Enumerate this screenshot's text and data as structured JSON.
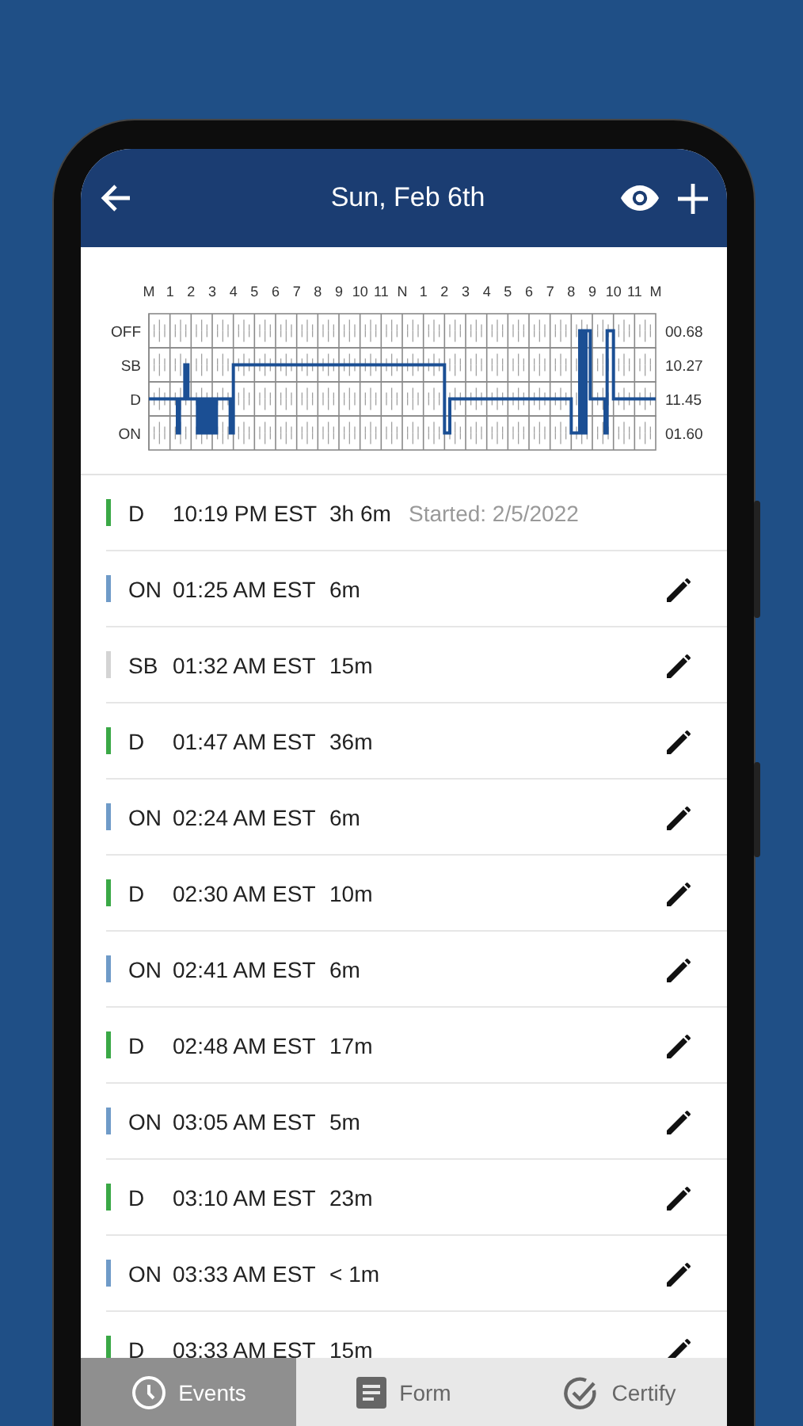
{
  "header": {
    "title": "Sun, Feb 6th"
  },
  "log_graph": {
    "hour_labels": [
      "M",
      "1",
      "2",
      "3",
      "4",
      "5",
      "6",
      "7",
      "8",
      "9",
      "10",
      "11",
      "N",
      "1",
      "2",
      "3",
      "4",
      "5",
      "6",
      "7",
      "8",
      "9",
      "10",
      "11",
      "M"
    ],
    "status_labels": [
      "OFF",
      "SB",
      "D",
      "ON"
    ],
    "totals": [
      "00.68",
      "10.27",
      "11.45",
      "01.60"
    ]
  },
  "events": [
    {
      "status": "D",
      "color": "#3aa846",
      "time": "10:19 PM EST",
      "duration": "3h 6m",
      "note": "Started: 2/5/2022",
      "editable": false
    },
    {
      "status": "ON",
      "color": "#6f9bc8",
      "time": "01:25 AM EST",
      "duration": "6m",
      "editable": true
    },
    {
      "status": "SB",
      "color": "#d4d4d4",
      "time": "01:32 AM EST",
      "duration": "15m",
      "editable": true
    },
    {
      "status": "D",
      "color": "#3aa846",
      "time": "01:47 AM EST",
      "duration": "36m",
      "editable": true
    },
    {
      "status": "ON",
      "color": "#6f9bc8",
      "time": "02:24 AM EST",
      "duration": "6m",
      "editable": true
    },
    {
      "status": "D",
      "color": "#3aa846",
      "time": "02:30 AM EST",
      "duration": "10m",
      "editable": true
    },
    {
      "status": "ON",
      "color": "#6f9bc8",
      "time": "02:41 AM EST",
      "duration": "6m",
      "editable": true
    },
    {
      "status": "D",
      "color": "#3aa846",
      "time": "02:48 AM EST",
      "duration": "17m",
      "editable": true
    },
    {
      "status": "ON",
      "color": "#6f9bc8",
      "time": "03:05 AM EST",
      "duration": "5m",
      "editable": true
    },
    {
      "status": "D",
      "color": "#3aa846",
      "time": "03:10 AM EST",
      "duration": "23m",
      "editable": true
    },
    {
      "status": "ON",
      "color": "#6f9bc8",
      "time": "03:33 AM EST",
      "duration": "< 1m",
      "editable": true
    },
    {
      "status": "D",
      "color": "#3aa846",
      "time": "03:33 AM EST",
      "duration": "15m",
      "editable": true
    }
  ],
  "tabs": [
    {
      "label": "Events",
      "kind": "clock",
      "selected": true
    },
    {
      "label": "Form",
      "kind": "form",
      "selected": false
    },
    {
      "label": "Certify",
      "kind": "certify",
      "selected": false
    }
  ]
}
